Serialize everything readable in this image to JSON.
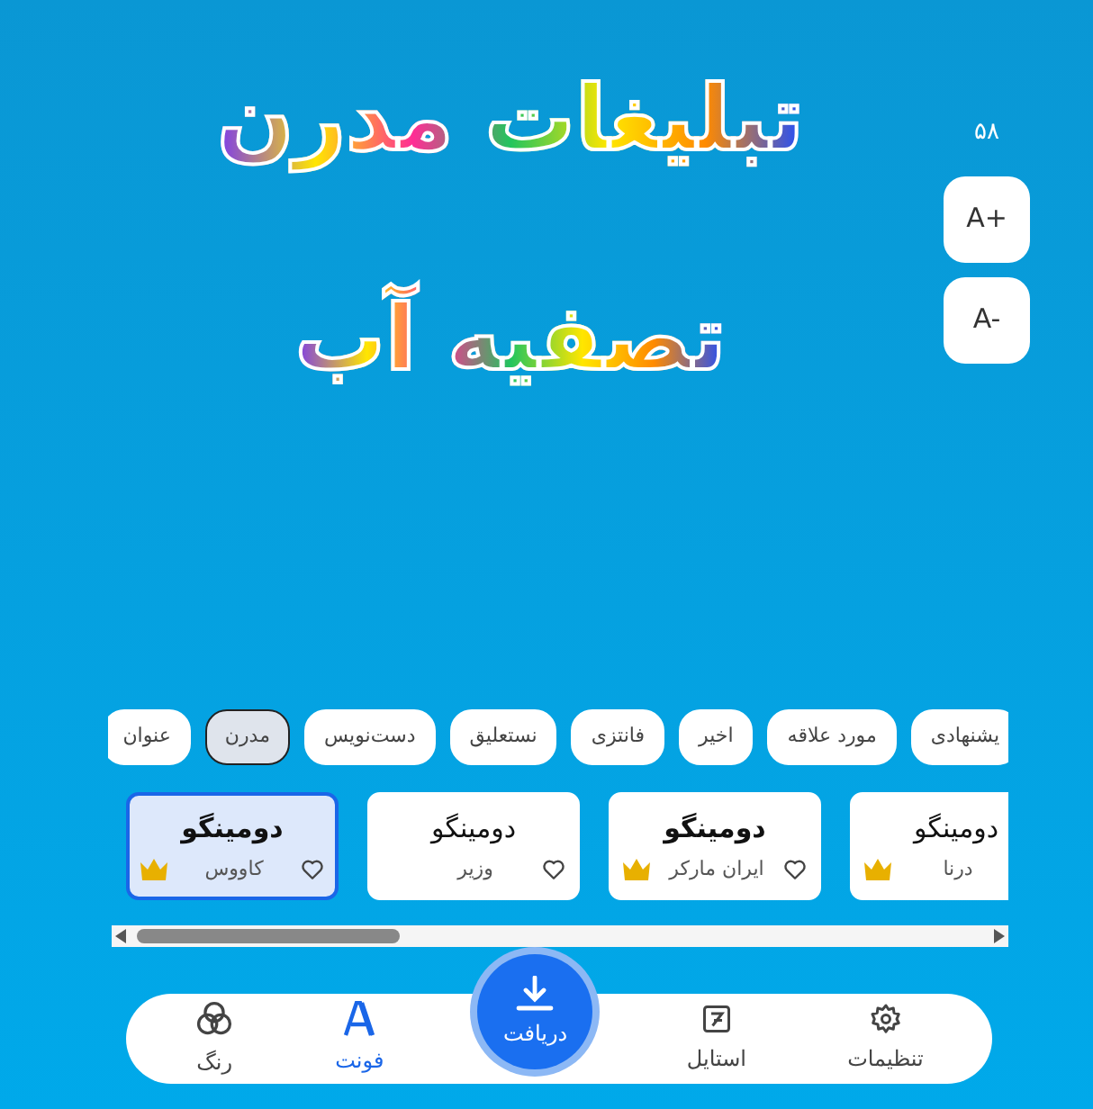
{
  "preview": {
    "lines": [
      "تبلیغات مدرن",
      "تصفیه آب"
    ]
  },
  "font_size": {
    "value": "۵۸",
    "increase": "A+",
    "decrease": "A-"
  },
  "categories": [
    {
      "label": "یشنهادی",
      "selected": false
    },
    {
      "label": "مورد علاقه",
      "selected": false
    },
    {
      "label": "اخیر",
      "selected": false
    },
    {
      "label": "فانتزی",
      "selected": false
    },
    {
      "label": "نستعلیق",
      "selected": false
    },
    {
      "label": "دست‌نویس",
      "selected": false
    },
    {
      "label": "مدرن",
      "selected": true
    },
    {
      "label": "عنوان",
      "selected": false
    }
  ],
  "fonts": [
    {
      "preview": "دومینگو",
      "name": "درنا",
      "bold": false,
      "favorite": false,
      "premium": true,
      "selected": false
    },
    {
      "preview": "دومینگو",
      "name": "ایران مارکر",
      "bold": true,
      "favorite": false,
      "premium": true,
      "selected": false
    },
    {
      "preview": "دومینگو",
      "name": "وزیر",
      "bold": false,
      "favorite": false,
      "premium": false,
      "selected": false
    },
    {
      "preview": "دومینگو",
      "name": "کاووس",
      "bold": true,
      "favorite": false,
      "premium": true,
      "selected": true
    }
  ],
  "nav": [
    {
      "kind": "settings",
      "label": "تنظیمات",
      "selected": false
    },
    {
      "kind": "style",
      "label": "استایل",
      "selected": false
    },
    {
      "kind": "download",
      "label": "دریافت",
      "selected": false
    },
    {
      "kind": "font",
      "label": "فونت",
      "selected": true
    },
    {
      "kind": "color",
      "label": "رنگ",
      "selected": false
    }
  ]
}
